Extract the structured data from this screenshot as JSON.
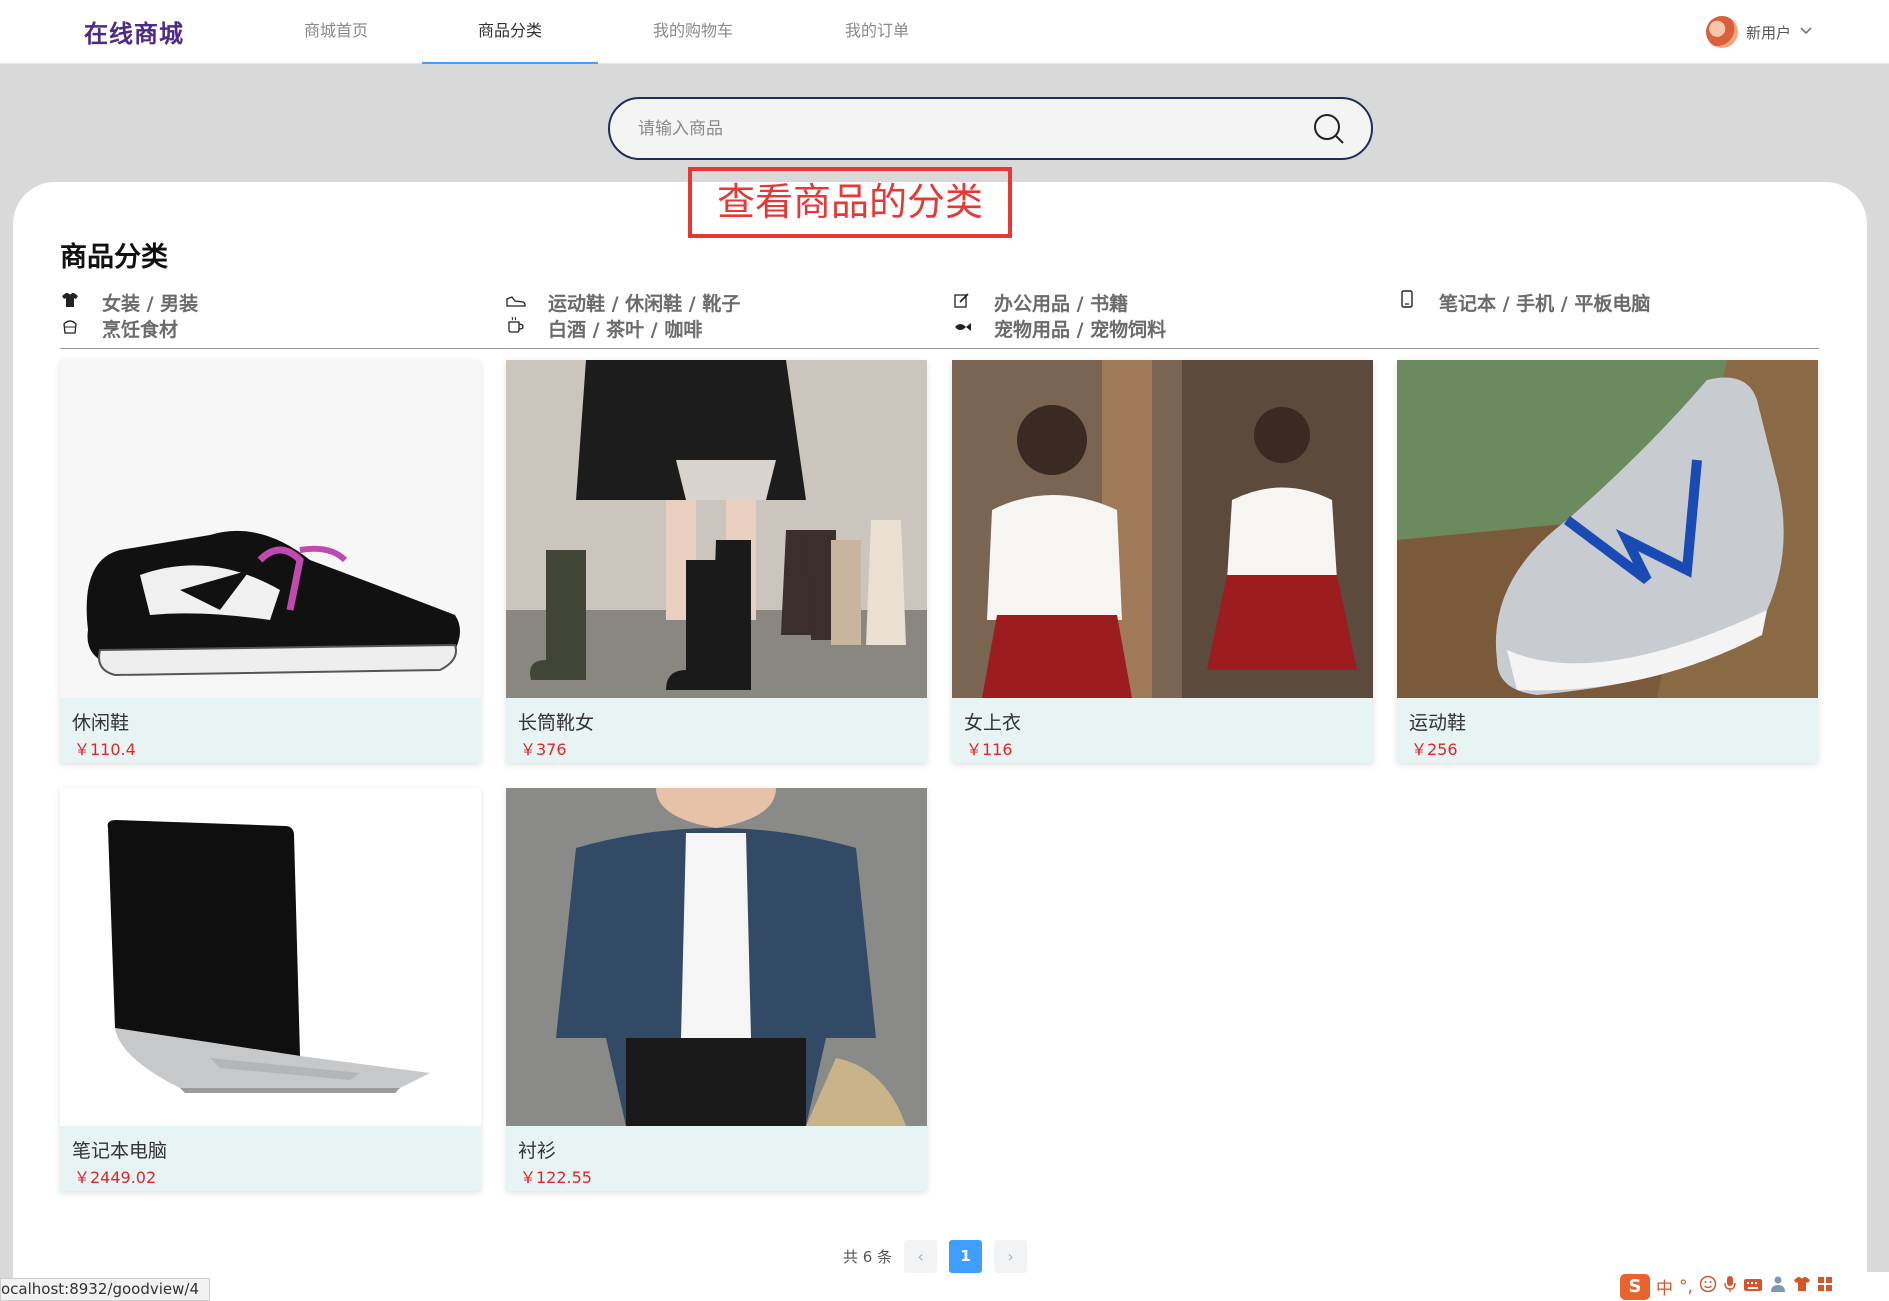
{
  "header": {
    "logo": "在线商城",
    "nav": [
      {
        "label": "商城首页",
        "active": false
      },
      {
        "label": "商品分类",
        "active": true
      },
      {
        "label": "我的购物车",
        "active": false
      },
      {
        "label": "我的订单",
        "active": false
      }
    ],
    "user": {
      "name": "新用户",
      "menu_icon": "chevron-down-icon"
    }
  },
  "search": {
    "placeholder": "请输入商品",
    "value": "",
    "icon": "search-icon"
  },
  "annotation": "查看商品的分类",
  "section_title": "商品分类",
  "categories": [
    {
      "icon": "shirt-icon",
      "label": "女装 / 男装"
    },
    {
      "icon": "sneaker-icon",
      "label": "运动鞋 / 休闲鞋 / 靴子"
    },
    {
      "icon": "edit-icon",
      "label": "办公用品 / 书籍"
    },
    {
      "icon": "phone-icon",
      "label": "笔记本 / 手机 / 平板电脑"
    },
    {
      "icon": "food-basket-icon",
      "label": "烹饪食材"
    },
    {
      "icon": "cup-icon",
      "label": "白酒 / 茶叶 / 咖啡"
    },
    {
      "icon": "fish-icon",
      "label": "宠物用品 / 宠物饲料"
    }
  ],
  "products": [
    {
      "name": "休闲鞋",
      "price": "￥110.4"
    },
    {
      "name": "长筒靴女",
      "price": "￥376"
    },
    {
      "name": "女上衣",
      "price": "￥116"
    },
    {
      "name": "运动鞋",
      "price": "￥256"
    },
    {
      "name": "笔记本电脑",
      "price": "￥2449.02"
    },
    {
      "name": "衬衫",
      "price": "￥122.55"
    }
  ],
  "pagination": {
    "total_text": "共 6 条",
    "current_page": "1",
    "prev": "‹",
    "next": "›"
  },
  "status_url": "ocalhost:8932/goodview/4",
  "ime": {
    "logo": "S",
    "lang": "中",
    "punct": "°,"
  },
  "colors": {
    "accent": "#409eff",
    "logo": "#4b2a8a",
    "price": "#e0262a",
    "annotation": "#e53935"
  }
}
